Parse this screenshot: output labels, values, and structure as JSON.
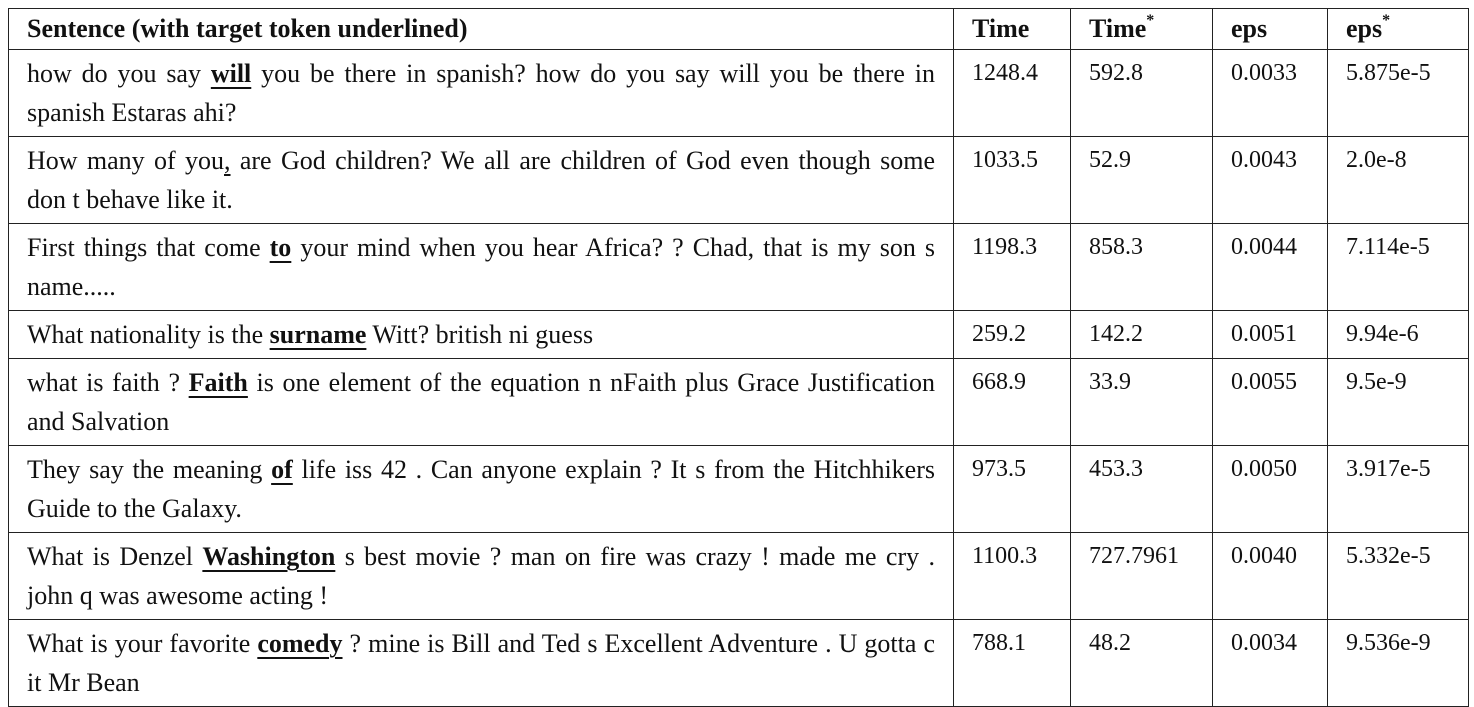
{
  "table": {
    "headers": {
      "sentence": "Sentence (with target token underlined)",
      "time": "Time",
      "time_star": "Time",
      "eps": "eps",
      "eps_star": "eps",
      "star": "*"
    },
    "rows": [
      {
        "before": "how do you say ",
        "target": "will",
        "target_bold": true,
        "after": " you be there in spanish? how do you say will you be there in spanish Estaras ahi?",
        "time": "1248.4",
        "time_star": "592.8",
        "eps": "0.0033",
        "eps_star": "5.875e-5"
      },
      {
        "before": "How many of you",
        "target": ",",
        "target_bold": false,
        "after": " are God children? We all are children of God even though some don t behave like it.",
        "time": "1033.5",
        "time_star": "52.9",
        "eps": "0.0043",
        "eps_star": "2.0e-8"
      },
      {
        "before": "First things that come ",
        "target": "to",
        "target_bold": true,
        "after": " your mind when you hear Africa? ? Chad, that is my son s name.....",
        "time": "1198.3",
        "time_star": "858.3",
        "eps": "0.0044",
        "eps_star": "7.114e-5"
      },
      {
        "before": "What nationality is the ",
        "target": "surname",
        "target_bold": true,
        "after": " Witt? british ni guess",
        "time": "259.2",
        "time_star": "142.2",
        "eps": "0.0051",
        "eps_star": "9.94e-6"
      },
      {
        "before": "what is faith ? ",
        "target": "Faith",
        "target_bold": true,
        "after": " is one element of the equation n nFaith plus Grace Justification and Salvation",
        "time": "668.9",
        "time_star": "33.9",
        "eps": "0.0055",
        "eps_star": "9.5e-9"
      },
      {
        "before": "They say the meaning ",
        "target": "of",
        "target_bold": true,
        "after": " life iss 42 . Can anyone explain ? It s from the Hitchhikers Guide to the Galaxy.",
        "time": "973.5",
        "time_star": "453.3",
        "eps": "0.0050",
        "eps_star": "3.917e-5"
      },
      {
        "before": "What is Denzel ",
        "target": "Washington",
        "target_bold": true,
        "after": " s best movie ? man on fire was crazy ! made me cry . john q was awesome acting !",
        "time": "1100.3",
        "time_star": "727.7961",
        "eps": "0.0040",
        "eps_star": "5.332e-5"
      },
      {
        "before": "What is your favorite ",
        "target": "comedy",
        "target_bold": true,
        "after": " ? mine is Bill and Ted s Excellent Adventure . U gotta c it Mr Bean",
        "time": "788.1",
        "time_star": "48.2",
        "eps": "0.0034",
        "eps_star": "9.536e-9"
      }
    ]
  }
}
